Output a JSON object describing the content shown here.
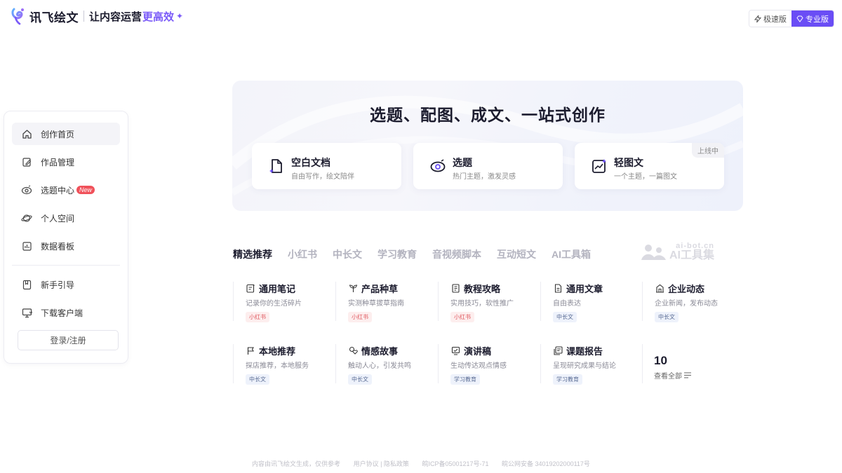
{
  "header": {
    "logo_name": "讯飞绘文",
    "slogan": "让内容运营",
    "slogan_highlight": "更高效",
    "versions": [
      {
        "label": "极速版",
        "active": false
      },
      {
        "label": "专业版",
        "active": true
      }
    ]
  },
  "sidebar": {
    "items": [
      {
        "label": "创作首页",
        "icon": "home-icon",
        "active": true
      },
      {
        "label": "作品管理",
        "icon": "edit-icon"
      },
      {
        "label": "选题中心",
        "icon": "eye-icon",
        "badge": "New"
      },
      {
        "label": "个人空间",
        "icon": "planet-icon"
      },
      {
        "label": "数据看板",
        "icon": "chart-icon"
      },
      {
        "label": "新手引导",
        "icon": "bookmark-icon"
      },
      {
        "label": "下载客户端",
        "icon": "monitor-icon"
      }
    ],
    "login_label": "登录/注册"
  },
  "hero": {
    "title": "选题、配图、成文、一站式创作",
    "cards": [
      {
        "title": "空白文档",
        "subtitle": "自由写作，绘文陪伴",
        "icon": "document-icon"
      },
      {
        "title": "选题",
        "subtitle": "热门主题，激发灵感",
        "icon": "eye-icon"
      },
      {
        "title": "轻图文",
        "subtitle": "一个主题，一篇图文",
        "icon": "image-chart-icon",
        "tag": "上线中"
      }
    ]
  },
  "tabs": [
    "精选推荐",
    "小红书",
    "中长文",
    "学习教育",
    "音视频脚本",
    "互动短文",
    "AI工具箱"
  ],
  "active_tab": "精选推荐",
  "watermark": {
    "line1": "ai-bot.cn",
    "line2": "AI工具集"
  },
  "templates": [
    {
      "title": "通用笔记",
      "desc": "记录你的生活碎片",
      "tag": "小红书",
      "tag_color": "red",
      "icon": "note-icon"
    },
    {
      "title": "产品种草",
      "desc": "实测种草拔草指南",
      "tag": "小红书",
      "tag_color": "red",
      "icon": "sprout-icon"
    },
    {
      "title": "教程攻略",
      "desc": "实用技巧，软性推广",
      "tag": "小红书",
      "tag_color": "red",
      "icon": "book-icon"
    },
    {
      "title": "通用文章",
      "desc": "自由表达",
      "tag": "中长文",
      "tag_color": "blue",
      "icon": "article-icon"
    },
    {
      "title": "企业动态",
      "desc": "企业新闻，发布动态",
      "tag": "中长文",
      "tag_color": "blue",
      "icon": "building-icon"
    },
    {
      "title": "本地推荐",
      "desc": "探店推荐，本地服务",
      "tag": "中长文",
      "tag_color": "blue",
      "icon": "flag-icon"
    },
    {
      "title": "情感故事",
      "desc": "触动人心，引发共鸣",
      "tag": "中长文",
      "tag_color": "blue",
      "icon": "heart-icon"
    },
    {
      "title": "演讲稿",
      "desc": "生动传达观点情感",
      "tag": "学习教育",
      "tag_color": "blue",
      "icon": "speech-icon"
    },
    {
      "title": "课题报告",
      "desc": "呈现研究成果与结论",
      "tag": "学习教育",
      "tag_color": "blue",
      "icon": "report-icon"
    }
  ],
  "more": {
    "count": "10",
    "label": "查看全部"
  },
  "footer": {
    "notice": "内容由讯飞绘文生成，仅供参考",
    "links": "用户协议 | 隐私政策",
    "icp": "皖ICP备05001217号-71",
    "police": "皖公网安备 34019202000117号"
  },
  "colors": {
    "accent": "#6a4df5",
    "slogan_highlight": "#7a5af8",
    "badge_red": "#f0515a"
  }
}
